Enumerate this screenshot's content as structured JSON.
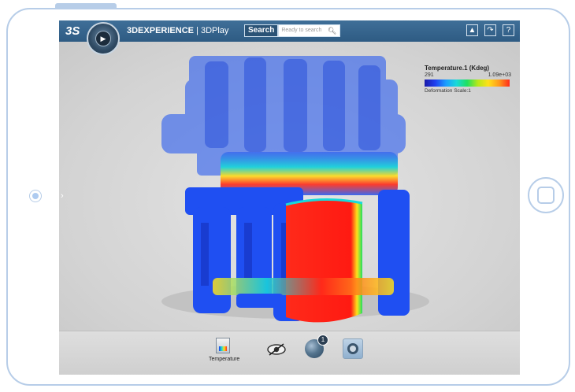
{
  "app": {
    "brand_mark": "3S",
    "title_bold": "3DEXPERIENCE",
    "title_rest": " | 3DPlay"
  },
  "search": {
    "button_label": "Search",
    "placeholder": "Ready to search"
  },
  "toolbar_icons": [
    "user-icon",
    "share-icon",
    "help-icon"
  ],
  "legend": {
    "title": "Temperature.1 (Kdeg)",
    "min": "291",
    "max": "1.09e+03",
    "scale_text": "Deformation Scale:1"
  },
  "bottom_bar": {
    "temperature_label": "Temperature",
    "badge_count": "1",
    "icons": [
      "temperature-result-icon",
      "hide-show-icon",
      "sphere-icon",
      "view-mode-icon"
    ]
  },
  "colors": {
    "topbar": "#34628b",
    "frame": "#b7cde8",
    "hot": "#ff2a1a",
    "cold": "#1f3ff0"
  }
}
